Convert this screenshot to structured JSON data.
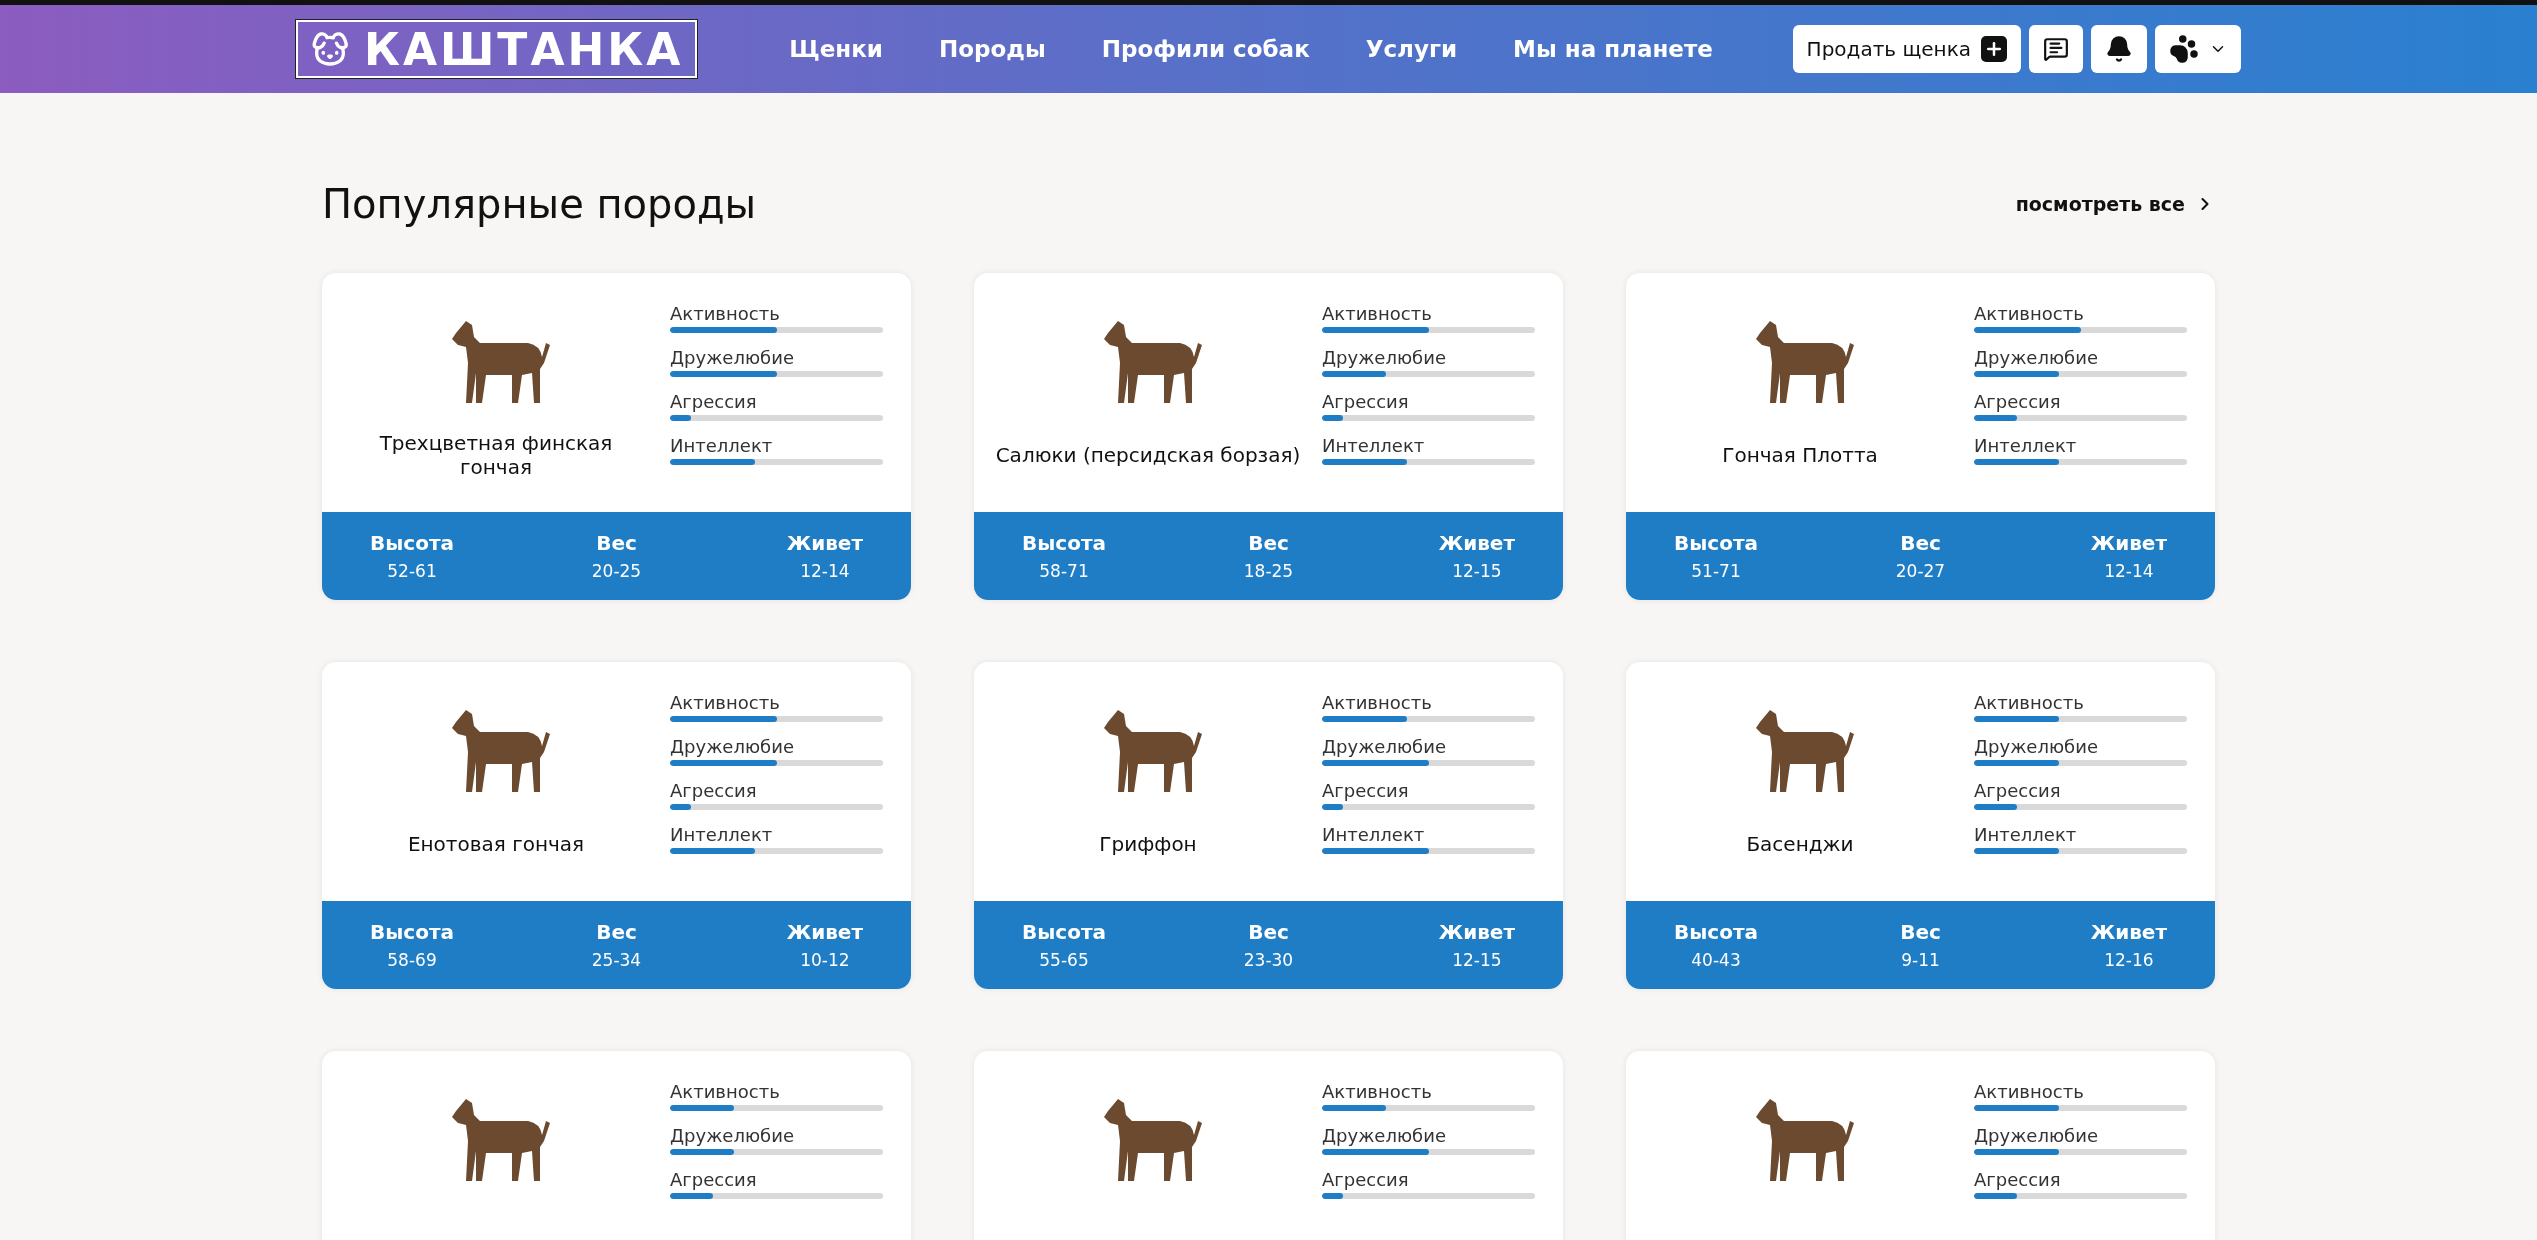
{
  "header": {
    "logo": "КАШТАНКА",
    "nav": [
      "Щенки",
      "Породы",
      "Профили собак",
      "Услуги",
      "Мы на планете"
    ],
    "sell_button": "Продать щенка"
  },
  "section": {
    "title": "Популярные породы",
    "see_all": "посмотреть все"
  },
  "cards": [
    {
      "name": "Трехцветная финская гончая",
      "stats": [
        {
          "label": "Активность",
          "level": 0.5
        },
        {
          "label": "Дружелюбие",
          "level": 0.5
        },
        {
          "label": "Агрессия",
          "level": 0.1
        },
        {
          "label": "Интеллект",
          "level": 0.4
        }
      ],
      "facts": [
        {
          "label": "Высота",
          "value": "52-61"
        },
        {
          "label": "Вес",
          "value": "20-25"
        },
        {
          "label": "Живет",
          "value": "12-14"
        }
      ]
    },
    {
      "name": "Салюки (персидская борзая)",
      "stats": [
        {
          "label": "Активность",
          "level": 0.5
        },
        {
          "label": "Дружелюбие",
          "level": 0.3
        },
        {
          "label": "Агрессия",
          "level": 0.1
        },
        {
          "label": "Интеллект",
          "level": 0.4
        }
      ],
      "facts": [
        {
          "label": "Высота",
          "value": "58-71"
        },
        {
          "label": "Вес",
          "value": "18-25"
        },
        {
          "label": "Живет",
          "value": "12-15"
        }
      ]
    },
    {
      "name": "Гончая Плотта",
      "stats": [
        {
          "label": "Активность",
          "level": 0.5
        },
        {
          "label": "Дружелюбие",
          "level": 0.4
        },
        {
          "label": "Агрессия",
          "level": 0.2
        },
        {
          "label": "Интеллект",
          "level": 0.4
        }
      ],
      "facts": [
        {
          "label": "Высота",
          "value": "51-71"
        },
        {
          "label": "Вес",
          "value": "20-27"
        },
        {
          "label": "Живет",
          "value": "12-14"
        }
      ]
    },
    {
      "name": "Енотовая гончая",
      "stats": [
        {
          "label": "Активность",
          "level": 0.5
        },
        {
          "label": "Дружелюбие",
          "level": 0.5
        },
        {
          "label": "Агрессия",
          "level": 0.1
        },
        {
          "label": "Интеллект",
          "level": 0.4
        }
      ],
      "facts": [
        {
          "label": "Высота",
          "value": "58-69"
        },
        {
          "label": "Вес",
          "value": "25-34"
        },
        {
          "label": "Живет",
          "value": "10-12"
        }
      ]
    },
    {
      "name": "Гриффон",
      "stats": [
        {
          "label": "Активность",
          "level": 0.4
        },
        {
          "label": "Дружелюбие",
          "level": 0.5
        },
        {
          "label": "Агрессия",
          "level": 0.1
        },
        {
          "label": "Интеллект",
          "level": 0.5
        }
      ],
      "facts": [
        {
          "label": "Высота",
          "value": "55-65"
        },
        {
          "label": "Вес",
          "value": "23-30"
        },
        {
          "label": "Живет",
          "value": "12-15"
        }
      ]
    },
    {
      "name": "Басенджи",
      "stats": [
        {
          "label": "Активность",
          "level": 0.4
        },
        {
          "label": "Дружелюбие",
          "level": 0.4
        },
        {
          "label": "Агрессия",
          "level": 0.2
        },
        {
          "label": "Интеллект",
          "level": 0.4
        }
      ],
      "facts": [
        {
          "label": "Высота",
          "value": "40-43"
        },
        {
          "label": "Вес",
          "value": "9-11"
        },
        {
          "label": "Живет",
          "value": "12-16"
        }
      ]
    },
    {
      "stats": [
        {
          "label": "Активность",
          "level": 0.3
        },
        {
          "label": "Дружелюбие",
          "level": 0.3
        },
        {
          "label": "Агрессия",
          "level": 0.2
        }
      ]
    },
    {
      "stats": [
        {
          "label": "Активность",
          "level": 0.3
        },
        {
          "label": "Дружелюбие",
          "level": 0.5
        },
        {
          "label": "Агрессия",
          "level": 0.1
        }
      ]
    },
    {
      "stats": [
        {
          "label": "Активность",
          "level": 0.4
        },
        {
          "label": "Дружелюбие",
          "level": 0.4
        },
        {
          "label": "Агрессия",
          "level": 0.2
        }
      ]
    }
  ]
}
